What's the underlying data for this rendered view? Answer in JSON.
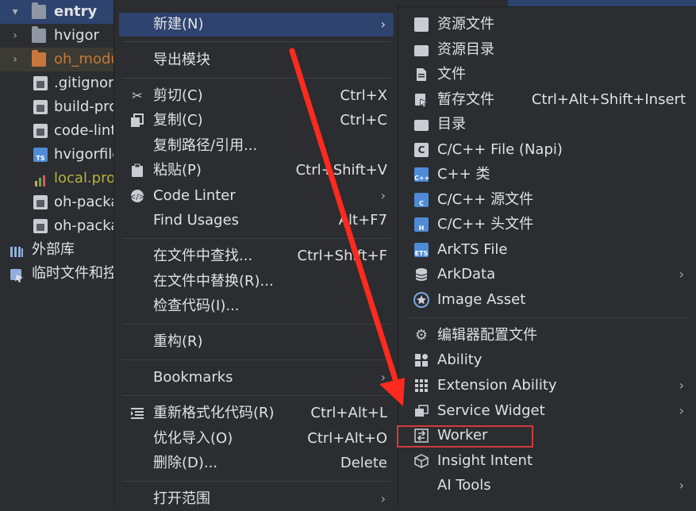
{
  "project_tree": [
    {
      "label": "entry",
      "icon": "folder-icon",
      "expanded": true,
      "selected": true
    },
    {
      "label": "hvigor",
      "icon": "folder-icon",
      "expanded": false
    },
    {
      "label": "oh_modu",
      "icon": "folder-orange-icon",
      "expanded": false,
      "highlight": true
    },
    {
      "label": ".gitignor",
      "icon": "file-icon"
    },
    {
      "label": "build-pro",
      "icon": "json-file-icon"
    },
    {
      "label": "code-lint",
      "icon": "json-file-icon"
    },
    {
      "label": "hvigorfile",
      "icon": "ts-file-icon"
    },
    {
      "label": "local.pro",
      "icon": "properties-file-icon"
    },
    {
      "label": "oh-packa",
      "icon": "json-file-icon"
    },
    {
      "label": "oh-packa",
      "icon": "json-file-icon"
    },
    {
      "label": "外部库",
      "icon": "library-icon"
    },
    {
      "label": "临时文件和控",
      "icon": "scratch-icon"
    }
  ],
  "context_menu": {
    "new": {
      "label": "新建(N)"
    },
    "export_module": "导出模块",
    "cut": {
      "label": "剪切(C)",
      "shortcut": "Ctrl+X"
    },
    "copy": {
      "label": "复制(C)",
      "shortcut": "Ctrl+C"
    },
    "copy_path": "复制路径/引用...",
    "paste": {
      "label": "粘贴(P)",
      "shortcut": "Ctrl+Shift+V"
    },
    "code_linter": "Code Linter",
    "find_usages": {
      "label": "Find Usages",
      "shortcut": "Alt+F7"
    },
    "find_in_files": {
      "label": "在文件中查找...",
      "shortcut": "Ctrl+Shift+F"
    },
    "replace_in_files": "在文件中替换(R)...",
    "inspect_code": "检查代码(I)...",
    "refactor": "重构(R)",
    "bookmarks": "Bookmarks",
    "reformat": {
      "label": "重新格式化代码(R)",
      "shortcut": "Ctrl+Alt+L"
    },
    "optimize_imports": {
      "label": "优化导入(O)",
      "shortcut": "Ctrl+Alt+O"
    },
    "delete": {
      "label": "删除(D)...",
      "shortcut": "Delete"
    },
    "open_in": "打开范围"
  },
  "new_submenu": {
    "resource_file": "资源文件",
    "resource_dir": "资源目录",
    "file": "文件",
    "scratch_file": {
      "label": "暂存文件",
      "shortcut": "Ctrl+Alt+Shift+Insert"
    },
    "directory": "目录",
    "cpp_napi": "C/C++ File (Napi)",
    "cpp_class": "C++ 类",
    "cpp_source": "C/C++ 源文件",
    "cpp_header": "C/C++ 头文件",
    "arkts_file": "ArkTS File",
    "arkdata": "ArkData",
    "image_asset": "Image Asset",
    "editor_config": "编辑器配置文件",
    "ability": "Ability",
    "extension_ability": "Extension Ability",
    "service_widget": "Service Widget",
    "worker": "Worker",
    "insight_intent": "Insight Intent",
    "ai_tools": "AI Tools"
  },
  "icon_text": {
    "cpp": "C++",
    "c": "C",
    "h": "H",
    "ets": "ETS",
    "ts": "TS",
    "napi": "C"
  },
  "colors": {
    "selection": "#2e436e",
    "annotation_red": "#ff2a1f",
    "highlight_box": "#d13b3b"
  }
}
